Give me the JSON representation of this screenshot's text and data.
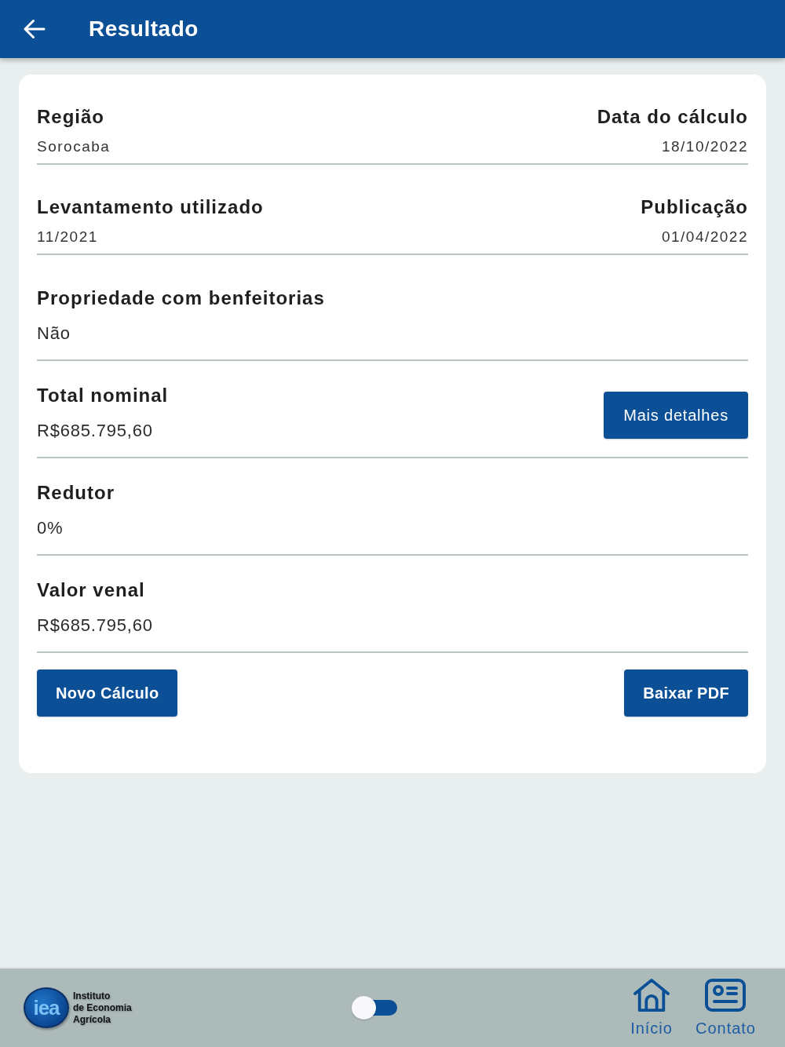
{
  "header": {
    "title": "Resultado"
  },
  "rows": [
    {
      "kind": "pair",
      "items": [
        {
          "label": "Região",
          "value": "Sorocaba"
        },
        {
          "label": "Data do cálculo",
          "value": "18/10/2022"
        }
      ]
    },
    {
      "kind": "pair",
      "items": [
        {
          "label": "Levantamento utilizado",
          "value": "11/2021"
        },
        {
          "label": "Publicação",
          "value": "01/04/2022"
        }
      ]
    },
    {
      "kind": "single",
      "items": [
        {
          "label": "Propriedade com benfeitorias",
          "value": "Não"
        }
      ]
    },
    {
      "kind": "action",
      "items": [
        {
          "label": "Total nominal",
          "value": "R$685.795,60"
        }
      ],
      "button": "Mais detalhes"
    },
    {
      "kind": "single",
      "items": [
        {
          "label": "Redutor",
          "value": "0%"
        }
      ]
    },
    {
      "kind": "single",
      "items": [
        {
          "label": "Valor venal",
          "value": "R$685.795,60"
        }
      ]
    }
  ],
  "actions": [
    "Novo Cálculo",
    "Baixar PDF"
  ],
  "footer": {
    "logo": {
      "mark": "iea",
      "lines": [
        "Instituto",
        "de Economia",
        "Agrícola"
      ]
    },
    "toggle": {
      "on": false
    },
    "nav": [
      {
        "kind": "home",
        "label": "Início"
      },
      {
        "kind": "contact",
        "label": "Contato"
      }
    ]
  }
}
